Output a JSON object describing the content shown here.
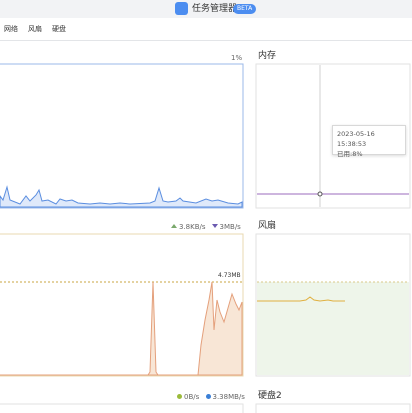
{
  "window": {
    "title": "任务管理器",
    "badge": "BETA",
    "accent_color": "#4c8df0",
    "icon": "app-icon"
  },
  "tabs": [
    {
      "label": "网络"
    },
    {
      "label": "风扇"
    },
    {
      "label": "硬盘"
    }
  ],
  "cpu_panel": {
    "percent_text": "1%",
    "line_color": "#5b8ee0"
  },
  "memory_panel": {
    "title": "内存",
    "line_color": "#9b6bbd",
    "tooltip": {
      "time": "2023-05-16 15:38:53",
      "usage": "已用:8%"
    }
  },
  "network_panel": {
    "upload_text": "3.8KB/s",
    "download_text": "3MB/s",
    "peak_label": "4.73MB",
    "fill_color": "#f5e6d8",
    "line_color": "#e0a07a"
  },
  "fan_panel": {
    "title": "风扇",
    "fill_color": "#eef5ea",
    "line_color": "#e0b040"
  },
  "disk_panel": {
    "read_text": "0B/s",
    "write_text": "3.38MB/s",
    "read_color": "#9bbb3a",
    "write_color": "#3a7fd6"
  },
  "disk2_panel": {
    "title": "硬盘2"
  }
}
